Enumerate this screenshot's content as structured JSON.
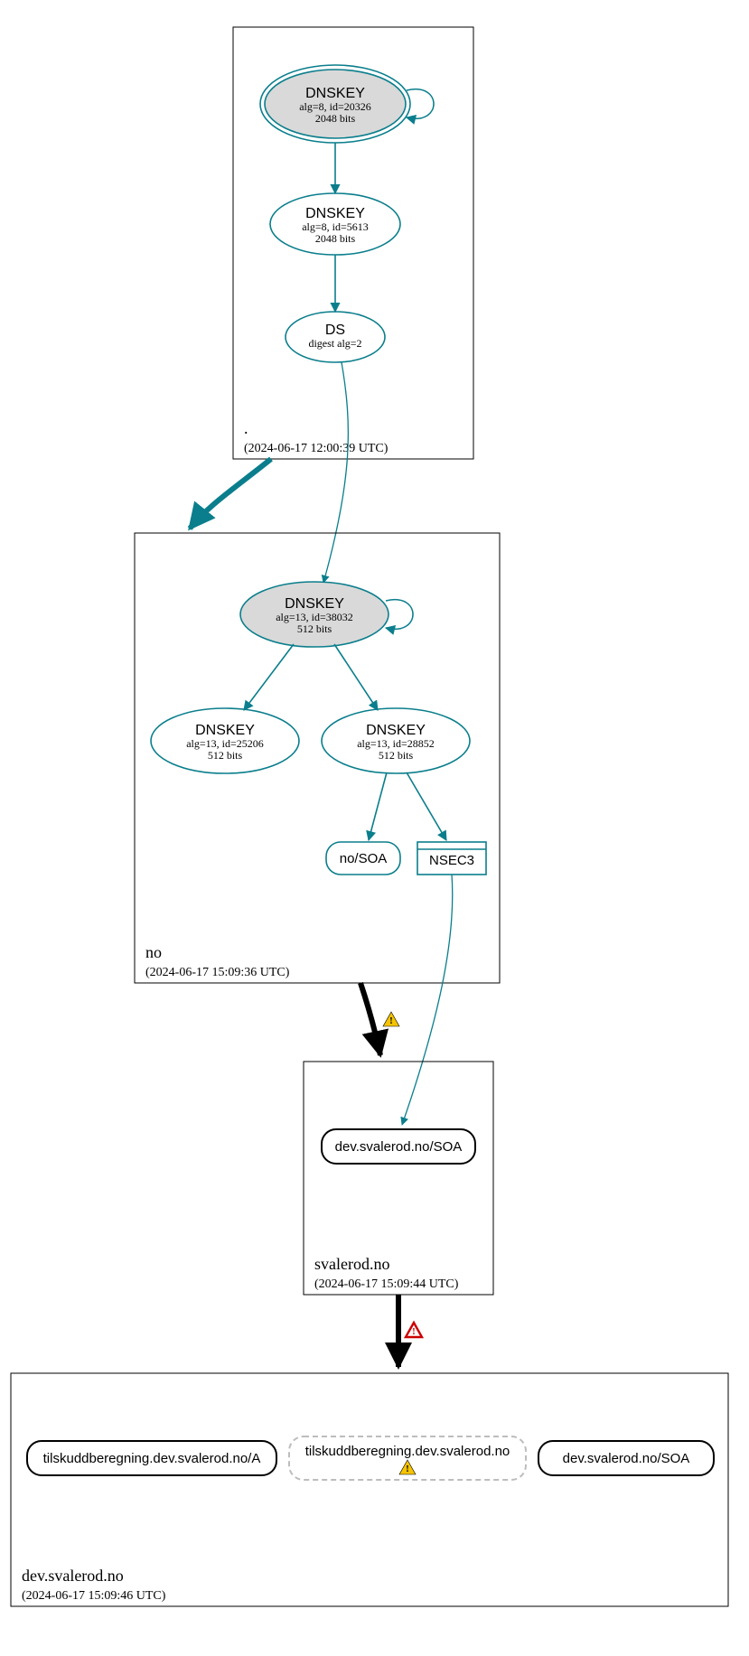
{
  "chart_data": {
    "type": "diagram",
    "description": "DNSSEC authentication / delegation chain graph",
    "zones": [
      {
        "id": "root",
        "label": ".",
        "timestamp": "(2024-06-17 12:00:39 UTC)",
        "nodes": [
          {
            "id": "root-ksk",
            "type": "DNSKEY",
            "detail1": "alg=8, id=20326",
            "detail2": "2048 bits",
            "style": "double-ellipse",
            "fill": "grey",
            "self_loop": true
          },
          {
            "id": "root-zsk",
            "type": "DNSKEY",
            "detail1": "alg=8, id=5613",
            "detail2": "2048 bits",
            "style": "ellipse",
            "fill": "white"
          },
          {
            "id": "root-ds",
            "type": "DS",
            "detail1": "digest alg=2",
            "style": "ellipse",
            "fill": "white"
          }
        ],
        "edges": [
          {
            "from": "root-ksk",
            "to": "root-ksk",
            "color": "teal"
          },
          {
            "from": "root-ksk",
            "to": "root-zsk",
            "color": "teal"
          },
          {
            "from": "root-zsk",
            "to": "root-ds",
            "color": "teal"
          }
        ]
      },
      {
        "id": "no",
        "label": "no",
        "timestamp": "(2024-06-17 15:09:36 UTC)",
        "nodes": [
          {
            "id": "no-ksk",
            "type": "DNSKEY",
            "detail1": "alg=13, id=38032",
            "detail2": "512 bits",
            "style": "ellipse",
            "fill": "grey",
            "self_loop": true
          },
          {
            "id": "no-zsk1",
            "type": "DNSKEY",
            "detail1": "alg=13, id=25206",
            "detail2": "512 bits",
            "style": "ellipse",
            "fill": "white"
          },
          {
            "id": "no-zsk2",
            "type": "DNSKEY",
            "detail1": "alg=13, id=28852",
            "detail2": "512 bits",
            "style": "ellipse",
            "fill": "white"
          },
          {
            "id": "no-soa",
            "type": "no/SOA",
            "style": "rounded-rect",
            "fill": "white"
          },
          {
            "id": "no-nsec3",
            "type": "NSEC3",
            "style": "tab-rect",
            "fill": "white"
          }
        ],
        "edges": [
          {
            "from": "no-ksk",
            "to": "no-ksk",
            "color": "teal"
          },
          {
            "from": "no-ksk",
            "to": "no-zsk1",
            "color": "teal"
          },
          {
            "from": "no-ksk",
            "to": "no-zsk2",
            "color": "teal"
          },
          {
            "from": "no-zsk2",
            "to": "no-soa",
            "color": "teal"
          },
          {
            "from": "no-zsk2",
            "to": "no-nsec3",
            "color": "teal"
          }
        ]
      },
      {
        "id": "svalerod",
        "label": "svalerod.no",
        "timestamp": "(2024-06-17 15:09:44 UTC)",
        "nodes": [
          {
            "id": "svalerod-soa",
            "type": "dev.svalerod.no/SOA",
            "style": "rounded-rect-black",
            "fill": "white"
          }
        ]
      },
      {
        "id": "dev",
        "label": "dev.svalerod.no",
        "timestamp": "(2024-06-17 15:09:46 UTC)",
        "nodes": [
          {
            "id": "dev-a",
            "type": "tilskuddberegning.dev.svalerod.no/A",
            "style": "rounded-rect-black",
            "fill": "white"
          },
          {
            "id": "dev-name",
            "type": "tilskuddberegning.dev.svalerod.no",
            "style": "rounded-rect-dashed",
            "fill": "white",
            "warn": true
          },
          {
            "id": "dev-soa",
            "type": "dev.svalerod.no/SOA",
            "style": "rounded-rect-black",
            "fill": "white"
          }
        ]
      }
    ],
    "cross_zone_edges": [
      {
        "from": "root",
        "to": "no",
        "color": "teal",
        "thick": true
      },
      {
        "from": "root-ds",
        "to": "no-ksk",
        "color": "teal"
      },
      {
        "from": "no",
        "to": "svalerod",
        "color": "black",
        "thick": true,
        "warn": "yellow"
      },
      {
        "from": "no-nsec3",
        "to": "svalerod-soa",
        "color": "teal"
      },
      {
        "from": "svalerod",
        "to": "dev",
        "color": "black",
        "thick": true,
        "warn": "red"
      }
    ]
  },
  "zones": {
    "root": {
      "label": ".",
      "timestamp": "(2024-06-17 12:00:39 UTC)"
    },
    "no": {
      "label": "no",
      "timestamp": "(2024-06-17 15:09:36 UTC)"
    },
    "svalerod": {
      "label": "svalerod.no",
      "timestamp": "(2024-06-17 15:09:44 UTC)"
    },
    "dev": {
      "label": "dev.svalerod.no",
      "timestamp": "(2024-06-17 15:09:46 UTC)"
    }
  },
  "nodes": {
    "root_ksk": {
      "title": "DNSKEY",
      "l1": "alg=8, id=20326",
      "l2": "2048 bits"
    },
    "root_zsk": {
      "title": "DNSKEY",
      "l1": "alg=8, id=5613",
      "l2": "2048 bits"
    },
    "root_ds": {
      "title": "DS",
      "l1": "digest alg=2"
    },
    "no_ksk": {
      "title": "DNSKEY",
      "l1": "alg=13, id=38032",
      "l2": "512 bits"
    },
    "no_zsk1": {
      "title": "DNSKEY",
      "l1": "alg=13, id=25206",
      "l2": "512 bits"
    },
    "no_zsk2": {
      "title": "DNSKEY",
      "l1": "alg=13, id=28852",
      "l2": "512 bits"
    },
    "no_soa": {
      "label": "no/SOA"
    },
    "no_nsec3": {
      "label": "NSEC3"
    },
    "svalerod_soa": {
      "label": "dev.svalerod.no/SOA"
    },
    "dev_a": {
      "label": "tilskuddberegning.dev.svalerod.no/A"
    },
    "dev_name": {
      "label": "tilskuddberegning.dev.svalerod.no"
    },
    "dev_soa": {
      "label": "dev.svalerod.no/SOA"
    }
  }
}
